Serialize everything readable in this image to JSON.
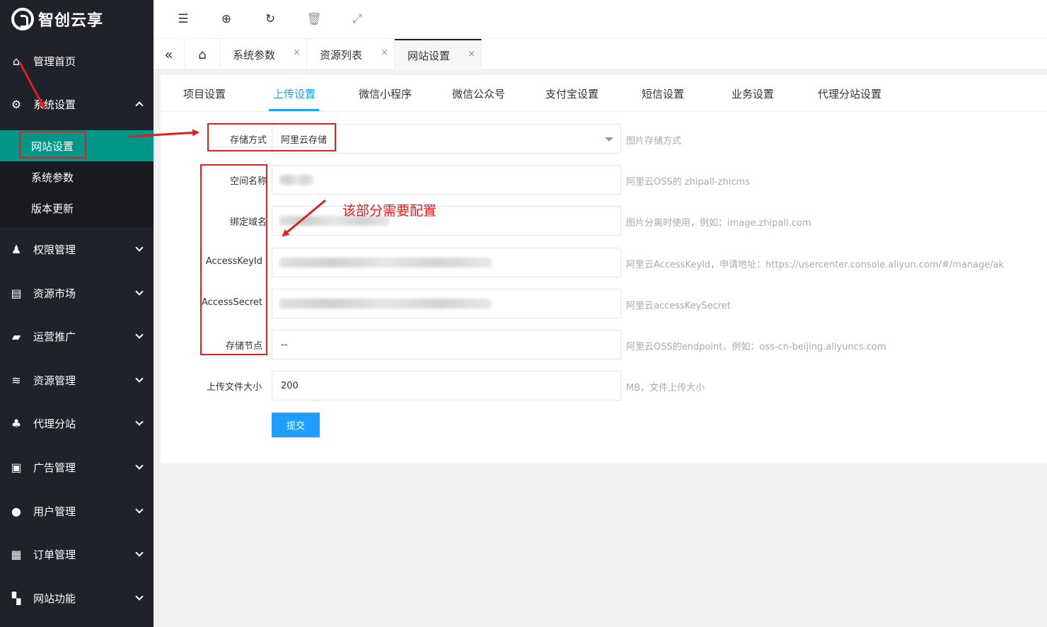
{
  "brand": {
    "logo_text": "智创云享"
  },
  "sidebar": {
    "home": "管理首页",
    "system": "系统设置",
    "system_sub": [
      "网站设置",
      "系统参数",
      "版本更新"
    ],
    "groups": [
      "权限管理",
      "资源市场",
      "运营推广",
      "资源管理",
      "代理分站",
      "广告管理",
      "用户管理",
      "订单管理",
      "网站功能"
    ]
  },
  "tabsbar": {
    "tabs": [
      "系统参数",
      "资源列表",
      "网站设置"
    ],
    "close": "×"
  },
  "settings_tabs": [
    "项目设置",
    "上传设置",
    "微信小程序",
    "微信公众号",
    "支付宝设置",
    "短信设置",
    "业务设置",
    "代理分站设置"
  ],
  "form": {
    "storage": {
      "label": "存储方式",
      "value": "阿里云存储",
      "hint": "图片存储方式"
    },
    "bucket": {
      "label": "空间名称",
      "hint": "阿里云OSS的 zhipall-zhicms"
    },
    "domain": {
      "label": "绑定域名",
      "hint": "图片分离时使用，例如：image.zhipall.com"
    },
    "key_id": {
      "label": "AccessKeyId",
      "hint": "阿里云AccessKeyId，申请地址：https://usercenter.console.aliyun.com/#/manage/ak"
    },
    "key_secret": {
      "label": "AccessSecret",
      "hint": "阿里云accessKeySecret"
    },
    "endpoint": {
      "label": "存储节点",
      "value": "--",
      "hint": "阿里云OSS的endpoint，例如：oss-cn-beijing.aliyuncs.com"
    },
    "max_size": {
      "label": "上传文件大小",
      "value": "200",
      "hint": "MB，文件上传大小"
    },
    "submit": "提交"
  },
  "annotation": {
    "note": "该部分需要配置"
  },
  "colors": {
    "sidebar_bg": "#20222a",
    "active_green": "#009688",
    "accent_blue": "#1e9fff",
    "annotation_red": "#e02020"
  }
}
